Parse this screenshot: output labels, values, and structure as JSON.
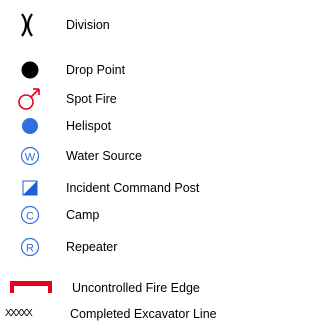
{
  "legend": {
    "items": [
      {
        "label": "Division",
        "icon": "division-icon"
      },
      {
        "label": "Drop Point",
        "icon": "drop-point-icon"
      },
      {
        "label": "Spot Fire",
        "icon": "spot-fire-icon"
      },
      {
        "label": "Helispot",
        "icon": "helispot-icon"
      },
      {
        "label": "Water Source",
        "icon": "water-source-icon",
        "symbol_text": "W"
      },
      {
        "label": "Incident Command Post",
        "icon": "incident-command-post-icon"
      },
      {
        "label": "Camp",
        "icon": "camp-icon",
        "symbol_text": "C"
      },
      {
        "label": "Repeater",
        "icon": "repeater-icon",
        "symbol_text": "R"
      },
      {
        "label": "Uncontrolled Fire Edge",
        "icon": "uncontrolled-fire-edge-icon"
      },
      {
        "label": "Completed Excavator Line",
        "icon": "completed-excavator-line-icon",
        "symbol_text": "XXXXX"
      }
    ],
    "colors": {
      "black": "#000000",
      "red": "#e8001c",
      "blue": "#2f6fe0",
      "icp_blue": "#1f5fd6"
    }
  }
}
